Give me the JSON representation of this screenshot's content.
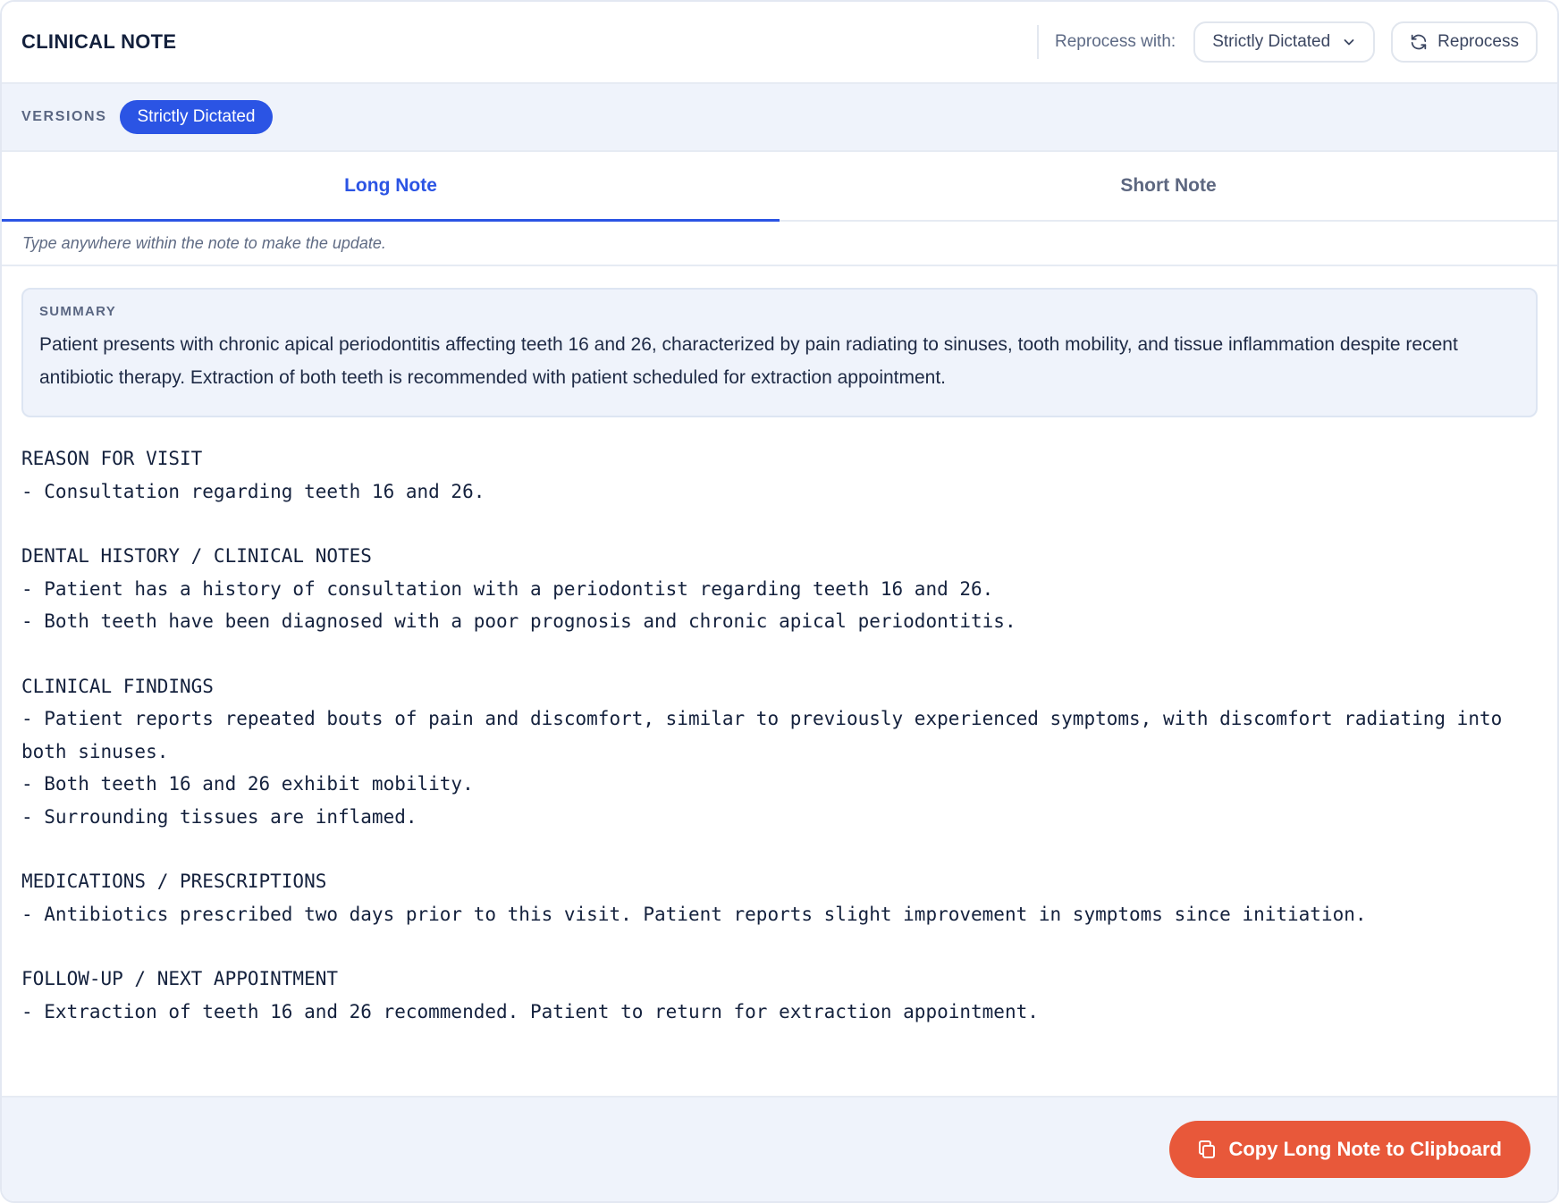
{
  "header": {
    "title": "CLINICAL NOTE",
    "reprocess_label": "Reprocess with:",
    "reprocess_select_value": "Strictly Dictated",
    "reprocess_button_label": "Reprocess"
  },
  "versions": {
    "label": "VERSIONS",
    "items": [
      "Strictly Dictated"
    ],
    "active": "Strictly Dictated"
  },
  "tabs": [
    {
      "label": "Long Note",
      "active": true
    },
    {
      "label": "Short Note",
      "active": false
    }
  ],
  "hint": "Type anywhere within the note to make the update.",
  "summary": {
    "label": "SUMMARY",
    "text": "Patient presents with chronic apical periodontitis affecting teeth 16 and 26, characterized by pain radiating to sinuses, tooth mobility, and tissue inflammation despite recent antibiotic therapy. Extraction of both teeth is recommended with patient scheduled for extraction appointment."
  },
  "note": {
    "sections": [
      {
        "heading": "REASON FOR VISIT",
        "lines": [
          "- Consultation regarding teeth 16 and 26."
        ]
      },
      {
        "heading": "DENTAL HISTORY / CLINICAL NOTES",
        "lines": [
          "- Patient has a history of consultation with a periodontist regarding teeth 16 and 26.",
          "- Both teeth have been diagnosed with a poor prognosis and chronic apical periodontitis."
        ]
      },
      {
        "heading": "CLINICAL FINDINGS",
        "lines": [
          "- Patient reports repeated bouts of pain and discomfort, similar to previously experienced symptoms, with discomfort radiating into both sinuses.",
          "- Both teeth 16 and 26 exhibit mobility.",
          "- Surrounding tissues are inflamed."
        ]
      },
      {
        "heading": "MEDICATIONS / PRESCRIPTIONS",
        "lines": [
          "- Antibiotics prescribed two days prior to this visit. Patient reports slight improvement in symptoms since initiation."
        ]
      },
      {
        "heading": "FOLLOW-UP / NEXT APPOINTMENT",
        "lines": [
          "- Extraction of teeth 16 and 26 recommended. Patient to return for extraction appointment."
        ]
      }
    ]
  },
  "footer": {
    "copy_button_label": "Copy Long Note to Clipboard"
  },
  "colors": {
    "accent_blue": "#2b54e4",
    "copy_button": "#e8583a",
    "panel_bg": "#eff3fb"
  },
  "icons": {
    "select": "chevron-down-icon",
    "reprocess": "refresh-icon",
    "copy": "copy-icon"
  }
}
